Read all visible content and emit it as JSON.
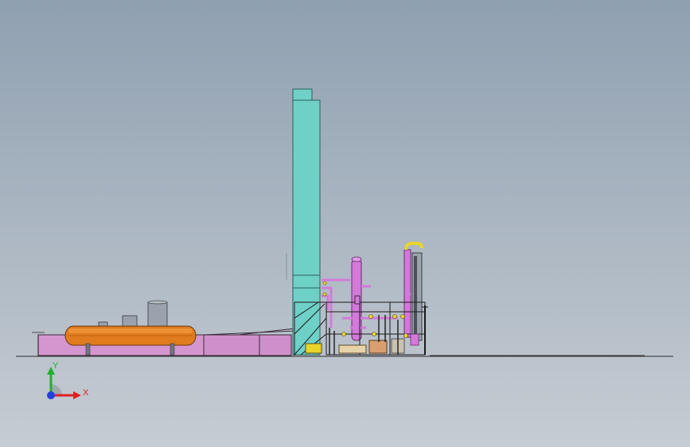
{
  "triad": {
    "x_label": "X",
    "y_label": "Y"
  },
  "colors": {
    "background_top": "#8fa0b1",
    "background_bottom": "#c6ccd3",
    "cold_box": "#6fd0c8",
    "tank_orange": "#e07b1e",
    "piping_magenta": "#d37ad9",
    "base_pink": "#d394cf",
    "vessel_gray": "#9aa3ad",
    "yellow_pipe": "#e8d52a",
    "axis_x": "#e02020",
    "axis_y": "#20b030",
    "axis_z": "#2040e0"
  }
}
